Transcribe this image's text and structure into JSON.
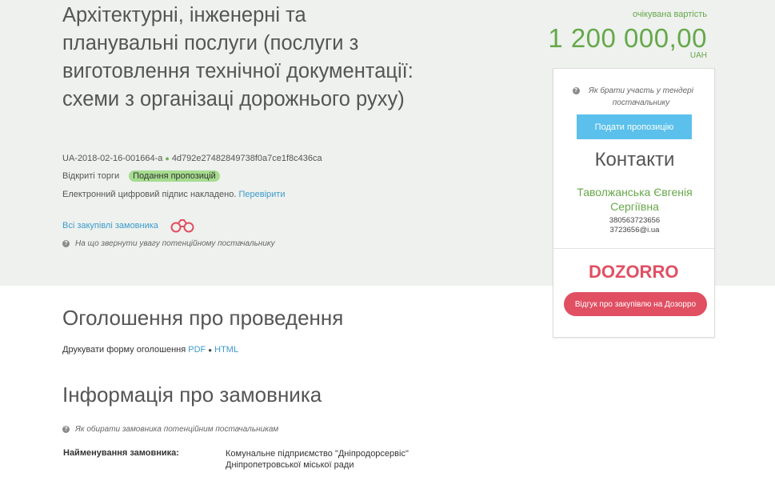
{
  "tender": {
    "title": "Архітектурні, інженерні та планувальні послуги (послуги з виготовлення технічної документації: схеми з організаці дорожнього руху)",
    "id": "UA-2018-02-16-001664-a",
    "hash": "4d792e27482849738f0a7ce1f8c436ca",
    "procedure": "Відкриті торги",
    "status_badge": "Подання пропозицій",
    "signature_text": "Електронний цифровий підпис накладено.",
    "signature_link": "Перевірити",
    "all_purchases_link": "Всі закупівлі замовника",
    "attention_hint": "На що звернути увагу потенційному постачальнику"
  },
  "cost": {
    "label": "очікувана вартість",
    "value": "1 200 000,00",
    "currency": "UAH"
  },
  "panel": {
    "participate_hint": "Як брати участь у тендері постачальнику",
    "submit_button": "Подати пропозицію",
    "contacts_title": "Контакти",
    "contact_name": "Таволжанська Євгенія Сергіївна",
    "contact_phone": "380563723656",
    "contact_email": "3723656@i.ua",
    "logo_text": "DOZORRO",
    "review_button": "Відгук про закупівлю на Дозорро"
  },
  "announcement": {
    "heading": "Оголошення про проведення",
    "print_label": "Друкувати форму оголошення",
    "pdf_link": "PDF",
    "html_link": "HTML"
  },
  "customer": {
    "heading": "Інформація про замовника",
    "hint": "Як обирати замовника потенційним постачальникам",
    "name_label": "Найменування замовника:",
    "name_value": "Комунальне підприємство \"Дніпродорсервіс\" Дніпропетровської міської ради"
  },
  "colors": {
    "accent_green": "#66a84a",
    "link_blue": "#3d9bcc",
    "badge_green": "#a6dc8f",
    "submit_blue": "#5bc0eb",
    "dozorro_red": "#e14f62",
    "hero_bg": "#eef1ee"
  }
}
